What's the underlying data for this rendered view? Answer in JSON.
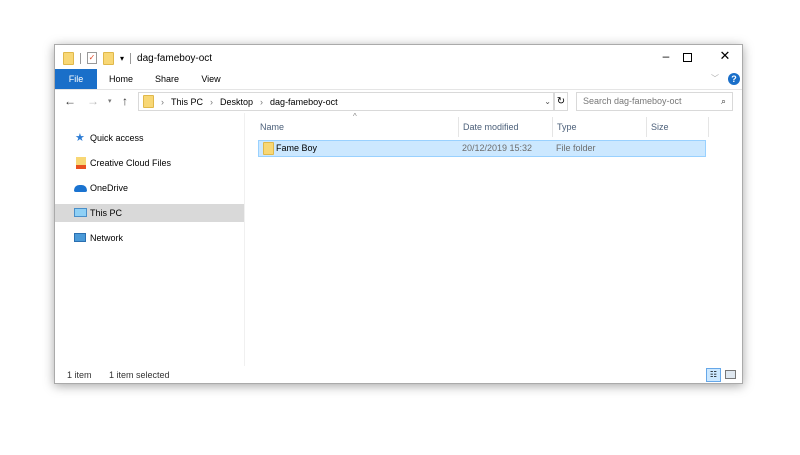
{
  "window": {
    "title": "dag-fameboy-oct"
  },
  "ribbon": {
    "tabs": [
      "File",
      "Home",
      "Share",
      "View"
    ]
  },
  "address": {
    "crumbs": [
      "This PC",
      "Desktop",
      "dag-fameboy-oct"
    ],
    "search_placeholder": "Search dag-fameboy-oct"
  },
  "sidebar": {
    "items": [
      {
        "label": "Quick access",
        "icon": "star-icon"
      },
      {
        "label": "Creative Cloud Files",
        "icon": "creative-cloud-icon"
      },
      {
        "label": "OneDrive",
        "icon": "cloud-icon"
      },
      {
        "label": "This PC",
        "icon": "monitor-icon",
        "selected": true
      },
      {
        "label": "Network",
        "icon": "network-icon"
      }
    ]
  },
  "columns": [
    "Name",
    "Date modified",
    "Type",
    "Size"
  ],
  "files": [
    {
      "name": "Fame Boy",
      "date": "20/12/2019 15:32",
      "type": "File folder",
      "size": ""
    }
  ],
  "status": {
    "count": "1 item",
    "selected": "1 item selected"
  },
  "colors": {
    "accent": "#1a6fc9",
    "selection": "#cce8ff",
    "sidebar_selected": "#d9d9d9"
  }
}
